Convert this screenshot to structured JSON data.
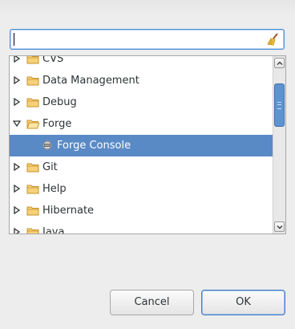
{
  "filter": {
    "value": "",
    "placeholder": ""
  },
  "tree": {
    "items": [
      {
        "label": "CVS",
        "expanded": false,
        "icon": "folder-icon"
      },
      {
        "label": "Data Management",
        "expanded": false,
        "icon": "folder-icon"
      },
      {
        "label": "Debug",
        "expanded": false,
        "icon": "folder-icon"
      },
      {
        "label": "Forge",
        "expanded": true,
        "icon": "folder-icon"
      },
      {
        "label": "Forge Console",
        "selected": true,
        "icon": "console-view-icon"
      },
      {
        "label": "Git",
        "expanded": false,
        "icon": "folder-icon"
      },
      {
        "label": "Help",
        "expanded": false,
        "icon": "folder-icon"
      },
      {
        "label": "Hibernate",
        "expanded": false,
        "icon": "folder-icon"
      },
      {
        "label": "Java",
        "expanded": false,
        "icon": "folder-icon"
      }
    ]
  },
  "buttons": {
    "cancel": "Cancel",
    "ok": "OK"
  },
  "colors": {
    "selection": "#5a8ac6",
    "focus_border": "#4a90d9",
    "folder": "#e8b64c",
    "scroll_thumb": "#5e93d1"
  }
}
